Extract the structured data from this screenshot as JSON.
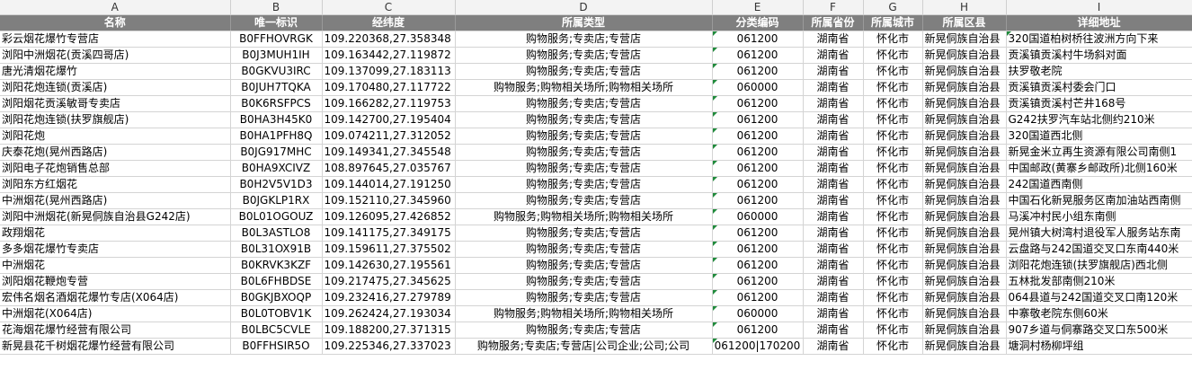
{
  "column_letters": [
    "A",
    "B",
    "C",
    "D",
    "E",
    "F",
    "G",
    "H",
    "I"
  ],
  "headers": [
    "名称",
    "唯一标识",
    "经纬度",
    "所属类型",
    "分类编码",
    "所属省份",
    "所属城市",
    "所属区县",
    "详细地址"
  ],
  "rows": [
    [
      "彩云烟花爆竹专营店",
      "B0FFHOVRGK",
      "109.220368,27.358348",
      "购物服务;专卖店;专营店",
      "061200",
      "湖南省",
      "怀化市",
      "新晃侗族自治县",
      "320国道柏树桥往波洲方向下来"
    ],
    [
      "浏阳中洲烟花(贡溪四哥店)",
      "B0J3MUH1IH",
      "109.163442,27.119872",
      "购物服务;专卖店;专营店",
      "061200",
      "湖南省",
      "怀化市",
      "新晃侗族自治县",
      "贡溪镇贡溪村牛场斜对面"
    ],
    [
      "唐光清烟花爆竹",
      "B0GKVU3IRC",
      "109.137099,27.183113",
      "购物服务;专卖店;专营店",
      "061200",
      "湖南省",
      "怀化市",
      "新晃侗族自治县",
      "扶罗敬老院"
    ],
    [
      "浏阳花炮连锁(贡溪店)",
      "B0JUH7TQKA",
      "109.170480,27.117722",
      "购物服务;购物相关场所;购物相关场所",
      "060000",
      "湖南省",
      "怀化市",
      "新晃侗族自治县",
      "贡溪镇贡溪村委会门口"
    ],
    [
      "浏阳烟花贡溪敏哥专卖店",
      "B0K6RSFPCS",
      "109.166282,27.119753",
      "购物服务;专卖店;专营店",
      "061200",
      "湖南省",
      "怀化市",
      "新晃侗族自治县",
      "贡溪镇贡溪村芒井168号"
    ],
    [
      "浏阳花炮连锁(扶罗旗舰店)",
      "B0HA3H45K0",
      "109.142700,27.195404",
      "购物服务;专卖店;专营店",
      "061200",
      "湖南省",
      "怀化市",
      "新晃侗族自治县",
      "G242扶罗汽车站北侧约210米"
    ],
    [
      "浏阳花炮",
      "B0HA1PFH8Q",
      "109.074211,27.312052",
      "购物服务;专卖店;专营店",
      "061200",
      "湖南省",
      "怀化市",
      "新晃侗族自治县",
      "320国道西北侧"
    ],
    [
      "庆泰花炮(晃州西路店)",
      "B0JG917MHC",
      "109.149341,27.345548",
      "购物服务;专卖店;专营店",
      "061200",
      "湖南省",
      "怀化市",
      "新晃侗族自治县",
      "新晃金米立再生资源有限公司南侧1"
    ],
    [
      "浏阳电子花炮销售总部",
      "B0HA9XCIVZ",
      "108.897645,27.035767",
      "购物服务;专卖店;专营店",
      "061200",
      "湖南省",
      "怀化市",
      "新晃侗族自治县",
      "中国邮政(黄寨乡邮政所)北侧160米"
    ],
    [
      "浏阳东方红烟花",
      "B0H2V5V1D3",
      "109.144014,27.191250",
      "购物服务;专卖店;专营店",
      "061200",
      "湖南省",
      "怀化市",
      "新晃侗族自治县",
      "242国道西南侧"
    ],
    [
      "中洲烟花(晃州西路店)",
      "B0JGKLP1RX",
      "109.152110,27.345960",
      "购物服务;专卖店;专营店",
      "061200",
      "湖南省",
      "怀化市",
      "新晃侗族自治县",
      "中国石化新晃服务区南加油站西南侧"
    ],
    [
      "浏阳中洲烟花(新晃侗族自治县G242店)",
      "B0L01OGOUZ",
      "109.126095,27.426852",
      "购物服务;购物相关场所;购物相关场所",
      "060000",
      "湖南省",
      "怀化市",
      "新晃侗族自治县",
      "马溪冲村民小组东南侧"
    ],
    [
      "政翔烟花",
      "B0L3ASTLO8",
      "109.141175,27.349175",
      "购物服务;专卖店;专营店",
      "061200",
      "湖南省",
      "怀化市",
      "新晃侗族自治县",
      "晃州镇大树湾村退役军人服务站东南"
    ],
    [
      "多多烟花爆竹专卖店",
      "B0L31OX91B",
      "109.159611,27.375502",
      "购物服务;专卖店;专营店",
      "061200",
      "湖南省",
      "怀化市",
      "新晃侗族自治县",
      "云盘路与242国道交叉口东南440米"
    ],
    [
      "中洲烟花",
      "B0KRVK3KZF",
      "109.142630,27.195561",
      "购物服务;专卖店;专营店",
      "061200",
      "湖南省",
      "怀化市",
      "新晃侗族自治县",
      "浏阳花炮连锁(扶罗旗舰店)西北侧"
    ],
    [
      "浏阳烟花鞭炮专营",
      "B0L6FHBDSE",
      "109.217475,27.345625",
      "购物服务;专卖店;专营店",
      "061200",
      "湖南省",
      "怀化市",
      "新晃侗族自治县",
      "五林批发部南侧210米"
    ],
    [
      "宏伟名烟名酒烟花爆竹专店(X064店)",
      "B0GKJBXOQP",
      "109.232416,27.279789",
      "购物服务;专卖店;专营店",
      "061200",
      "湖南省",
      "怀化市",
      "新晃侗族自治县",
      "064县道与242国道交叉口南120米"
    ],
    [
      "中洲烟花(X064店)",
      "B0L0TOBV1K",
      "109.262424,27.193034",
      "购物服务;购物相关场所;购物相关场所",
      "060000",
      "湖南省",
      "怀化市",
      "新晃侗族自治县",
      "中寨敬老院东侧60米"
    ],
    [
      "花海烟花爆竹经营有限公司",
      "B0LBC5CVLE",
      "109.188200,27.371315",
      "购物服务;专卖店;专营店",
      "061200",
      "湖南省",
      "怀化市",
      "新晃侗族自治县",
      "907乡道与侗寨路交叉口东500米"
    ],
    [
      "新晃县花千树烟花爆竹经营有限公司",
      "B0FFHSIR5O",
      "109.225346,27.337023",
      "购物服务;专卖店;专营店|公司企业;公司;公司",
      "061200|170200",
      "湖南省",
      "怀化市",
      "新晃侗族自治县",
      "塘洞村杨柳坪组"
    ]
  ]
}
